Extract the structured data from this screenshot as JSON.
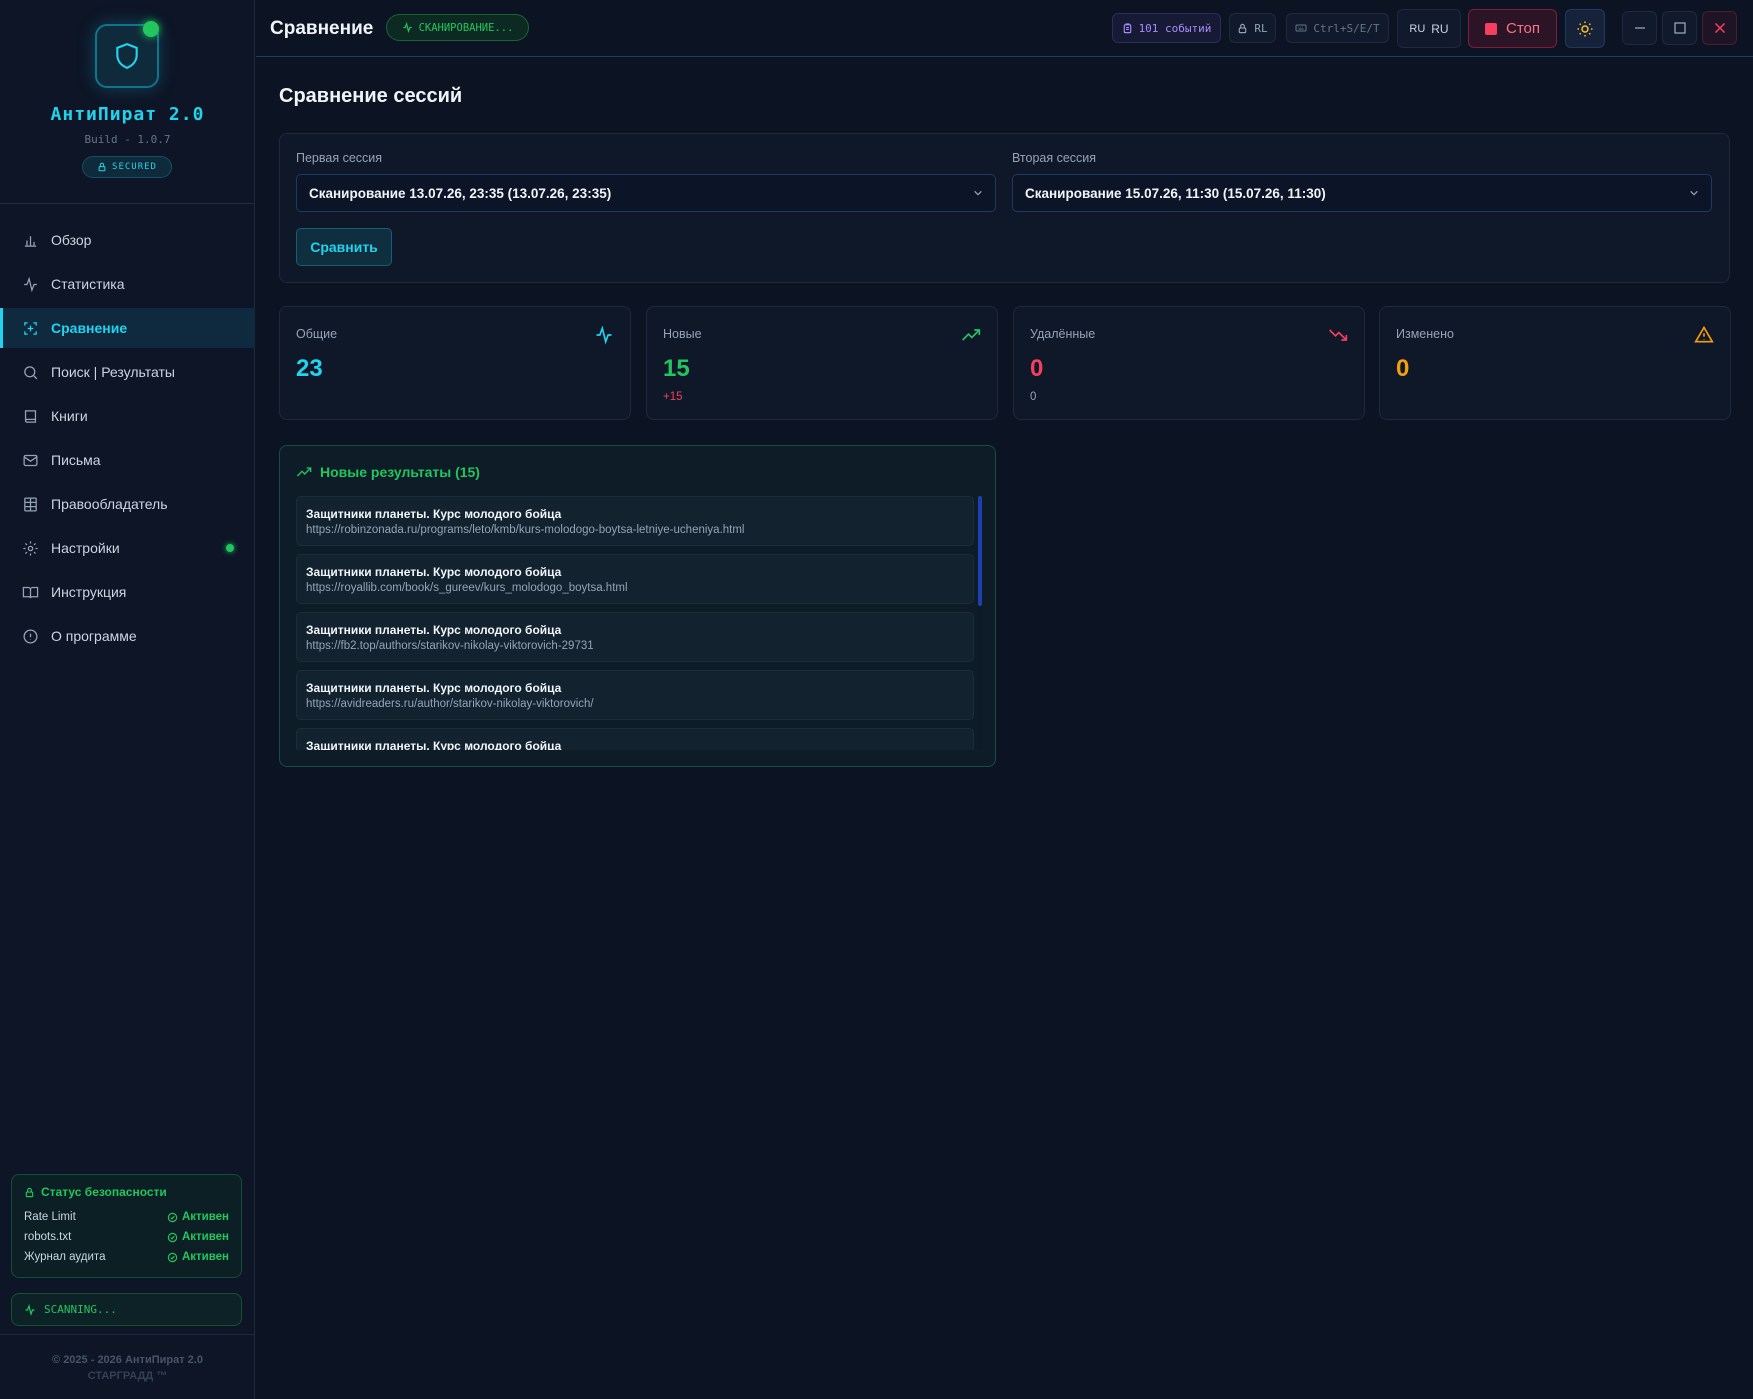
{
  "sidebar": {
    "brand_title": "АнтиПират 2.0",
    "build": "Build - 1.0.7",
    "secured": "SECURED",
    "items": [
      {
        "label": "Обзор",
        "icon": "bar-chart-icon"
      },
      {
        "label": "Статистика",
        "icon": "activity-icon"
      },
      {
        "label": "Сравнение",
        "icon": "compare-icon",
        "active": true
      },
      {
        "label": "Поиск | Результаты",
        "icon": "search-icon"
      },
      {
        "label": "Книги",
        "icon": "book-icon"
      },
      {
        "label": "Письма",
        "icon": "mail-icon"
      },
      {
        "label": "Правообладатель",
        "icon": "grid-icon"
      },
      {
        "label": "Настройки",
        "icon": "gear-icon"
      },
      {
        "label": "Инструкция",
        "icon": "open-book-icon"
      },
      {
        "label": "О программе",
        "icon": "info-icon"
      }
    ],
    "security": {
      "title": "Статус безопасности",
      "rows": [
        {
          "name": "Rate Limit",
          "status": "Активен"
        },
        {
          "name": "robots.txt",
          "status": "Активен"
        },
        {
          "name": "Журнал аудита",
          "status": "Активен"
        }
      ]
    },
    "scanning": "SCANNING...",
    "copyright_line1": "© 2025 - 2026 АнтиПират 2.0",
    "copyright_line2": "СТАРГРАДД ™"
  },
  "topbar": {
    "title": "Сравнение",
    "scan_badge": "СКАНИРОВАНИЕ...",
    "events": "101 событий",
    "rl": "RL",
    "shortcuts": "Ctrl+S/E/T",
    "lang_flag": "RU",
    "lang": "RU",
    "stop": "Стоп"
  },
  "main": {
    "page_title": "Сравнение сессий",
    "first_label": "Первая сессия",
    "first_value": "Сканирование 13.07.26, 23:35 (13.07.26, 23:35)",
    "second_label": "Вторая сессия",
    "second_value": "Сканирование 15.07.26, 11:30 (15.07.26, 11:30)",
    "compare_button": "Сравнить",
    "stats": [
      {
        "label": "Общие",
        "value": "23",
        "sub": "",
        "color": "#22d3ee"
      },
      {
        "label": "Новые",
        "value": "15",
        "sub": "+15",
        "color": "#22c55e",
        "sub_color": "#f43f5e"
      },
      {
        "label": "Удалённые",
        "value": "0",
        "sub": "0",
        "color": "#f43f5e",
        "sub_color": "#94a3b8"
      },
      {
        "label": "Изменено",
        "value": "0",
        "sub": "",
        "color": "#f59e0b"
      }
    ],
    "results_title": "Новые результаты (15)",
    "results": [
      {
        "title": "Защитники планеты. Курс молодого бойца",
        "url": "https://robinzonada.ru/programs/leto/kmb/kurs-molodogo-boytsa-letniye-ucheniya.html"
      },
      {
        "title": "Защитники планеты. Курс молодого бойца",
        "url": "https://royallib.com/book/s_gureev/kurs_molodogo_boytsa.html"
      },
      {
        "title": "Защитники планеты. Курс молодого бойца",
        "url": "https://fb2.top/authors/starikov-nikolay-viktorovich-29731"
      },
      {
        "title": "Защитники планеты. Курс молодого бойца",
        "url": "https://avidreaders.ru/author/starikov-nikolay-viktorovich/"
      },
      {
        "title": "Защитники планеты. Курс молодого бойца",
        "url": ""
      }
    ]
  }
}
